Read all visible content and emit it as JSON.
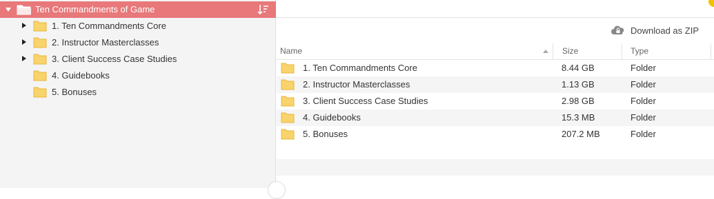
{
  "tree": {
    "root_label": "Ten Commandments of Game",
    "items": [
      {
        "label": "1. Ten Commandments Core",
        "expandable": true
      },
      {
        "label": "2. Instructor Masterclasses",
        "expandable": true
      },
      {
        "label": "3. Client Success Case Studies",
        "expandable": true
      },
      {
        "label": "4. Guidebooks",
        "expandable": false
      },
      {
        "label": "5. Bonuses",
        "expandable": false
      }
    ]
  },
  "toolbar": {
    "download_label": "Download as ZIP"
  },
  "table": {
    "columns": {
      "name": "Name",
      "size": "Size",
      "type": "Type"
    },
    "rows": [
      {
        "name": "1. Ten Commandments Core",
        "size": "8.44 GB",
        "type": "Folder"
      },
      {
        "name": "2. Instructor Masterclasses",
        "size": "1.13 GB",
        "type": "Folder"
      },
      {
        "name": "3. Client Success Case Studies",
        "size": "2.98 GB",
        "type": "Folder"
      },
      {
        "name": "4. Guidebooks",
        "size": "15.3 MB",
        "type": "Folder"
      },
      {
        "name": "5. Bonuses",
        "size": "207.2 MB",
        "type": "Folder"
      }
    ]
  },
  "colors": {
    "root_highlight": "#e8787a",
    "folder_fill": "#f9d36b",
    "folder_stroke": "#e8b73c"
  }
}
